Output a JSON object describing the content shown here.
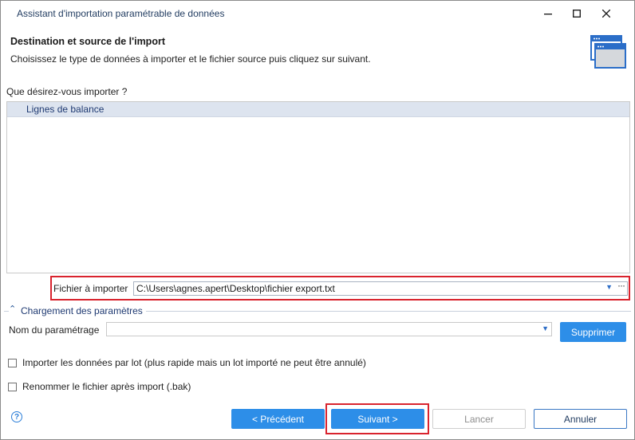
{
  "window": {
    "title": "Assistant d'importation paramétrable de données"
  },
  "header": {
    "title": "Destination et source de l'import",
    "description": "Choisissez le type de données à importer et le fichier source puis cliquez sur suivant.",
    "icon": "wizard-window-icon"
  },
  "question": {
    "label": "Que désirez-vous importer ?",
    "items": [
      "Lignes de balance"
    ]
  },
  "file": {
    "label": "Fichier à importer",
    "value": "C:\\Users\\agnes.apert\\Desktop\\fichier export.txt"
  },
  "section": {
    "title": "Chargement des paramètres"
  },
  "param": {
    "label": "Nom du paramétrage",
    "value": "",
    "delete_label": "Supprimer"
  },
  "options": {
    "batch_label": "Importer les données par lot (plus rapide mais un lot importé ne peut être annulé)",
    "rename_label": "Renommer le fichier après import (.bak)"
  },
  "footer": {
    "prev_label": "< Précédent",
    "next_label": "Suivant >",
    "launch_label": "Lancer",
    "cancel_label": "Annuler"
  },
  "colors": {
    "accent": "#2d8ee8",
    "highlight": "#d9232e",
    "selection": "#dde4ef"
  }
}
